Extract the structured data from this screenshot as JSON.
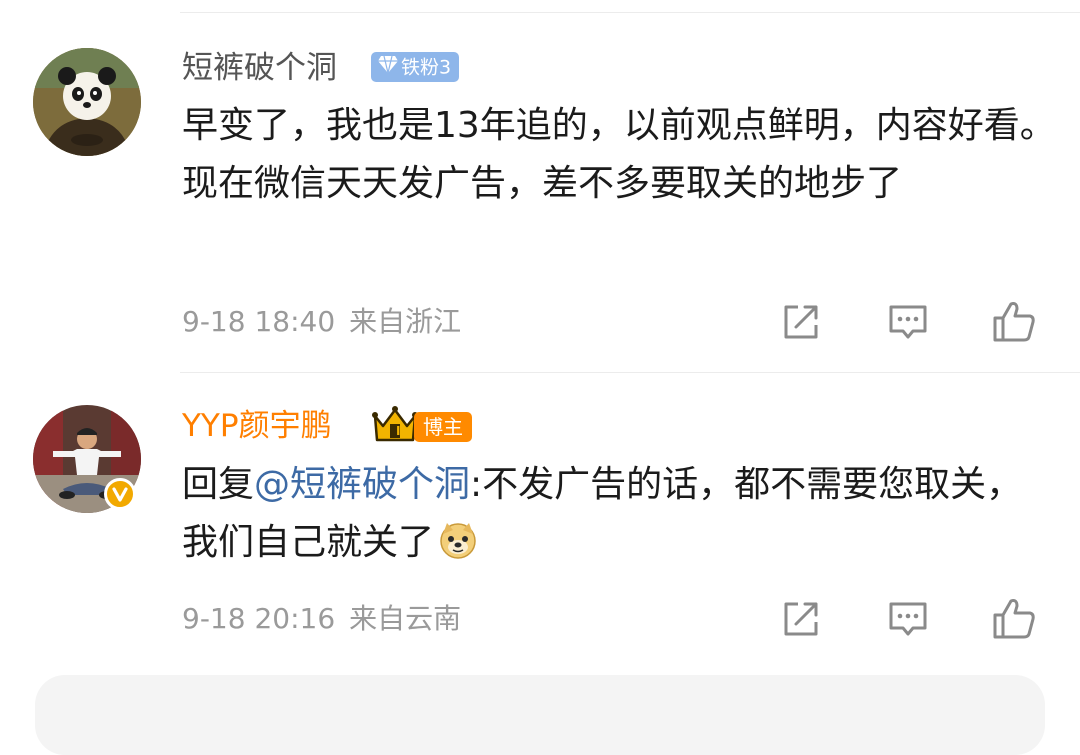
{
  "comments": [
    {
      "username": "短裤破个洞",
      "badge": "铁粉3",
      "text": "早变了，我也是13年追的，以前观点鲜明，内容好看。现在微信天天发广告，差不多要取关的地步了",
      "date": "9-18 18:40",
      "location": "来自浙江",
      "username_color": "#555555"
    },
    {
      "username": "YYP颜宇鹏",
      "badge": "博主",
      "crown_level": "II",
      "reply_prefix": "回复",
      "mention": "@短裤破个洞",
      "text": ":不发广告的话，都不需要您取关，我们自己就关了",
      "date": "9-18 20:16",
      "location": "来自云南",
      "username_color": "#ff7f00"
    }
  ],
  "icons": [
    "share-icon",
    "comment-icon",
    "like-icon",
    "doge-emoji-icon",
    "diamond-icon",
    "crown-icon",
    "verified-v-icon"
  ],
  "colors": {
    "mention": "#3d6aa5",
    "meta": "#9a9a9a",
    "fan_badge": "#8eb6ea",
    "blogger_badge": "#ff8a00"
  }
}
